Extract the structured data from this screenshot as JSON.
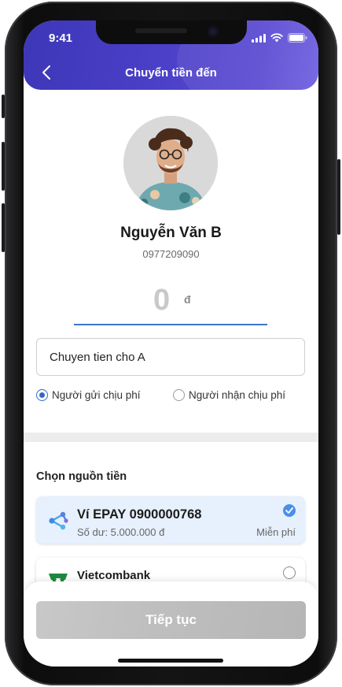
{
  "status_bar": {
    "time": "9:41"
  },
  "header": {
    "title": "Chuyển tiền đến"
  },
  "recipient": {
    "name": "Nguyễn Văn B",
    "phone": "0977209090"
  },
  "amount": {
    "value": "0",
    "currency": "đ"
  },
  "note": {
    "value": "Chuyen tien cho A"
  },
  "fee_options": [
    {
      "label": "Người gửi chịu phí",
      "selected": true
    },
    {
      "label": "Người nhận chịu phí",
      "selected": false
    }
  ],
  "source": {
    "section_title": "Chọn nguồn tiền",
    "items": [
      {
        "title": "Ví EPAY 0900000768",
        "subtitle": "Số dư: 5.000.000 đ",
        "fee": "Miễn phí",
        "selected": true,
        "icon": "epay-logo"
      },
      {
        "title": "Vietcombank",
        "selected": false,
        "icon": "vietcombank-logo"
      }
    ]
  },
  "footer": {
    "continue_label": "Tiếp tục"
  },
  "colors": {
    "header": "#4a3fc7",
    "accent": "#3468c4",
    "selected_card": "#e7f0fd",
    "button_disabled": "#c2c2c2"
  }
}
